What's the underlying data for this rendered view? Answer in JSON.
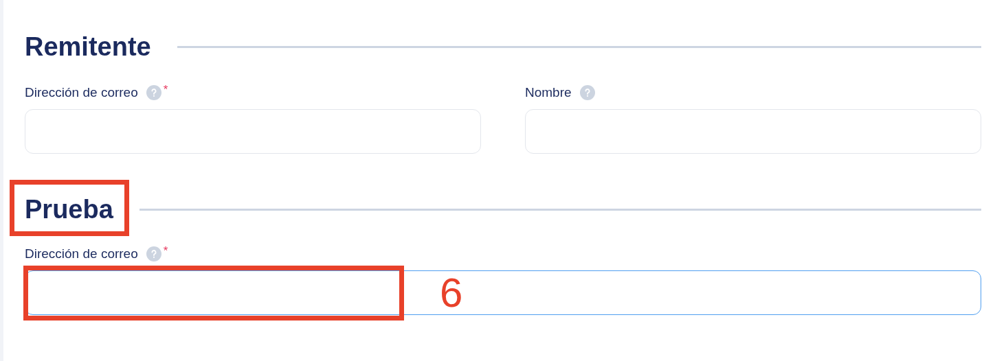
{
  "required_mark": "*",
  "sections": [
    {
      "title": "Remitente",
      "highlighted": false,
      "fields": [
        {
          "label": "Dirección de correo",
          "required": true,
          "focused": false,
          "highlighted": false
        },
        {
          "label": "Nombre",
          "required": false,
          "focused": false,
          "highlighted": false
        }
      ]
    },
    {
      "title": "Prueba",
      "highlighted": true,
      "fields": [
        {
          "label": "Dirección de correo",
          "required": true,
          "focused": true,
          "highlighted": true,
          "step": "6"
        }
      ]
    }
  ]
}
